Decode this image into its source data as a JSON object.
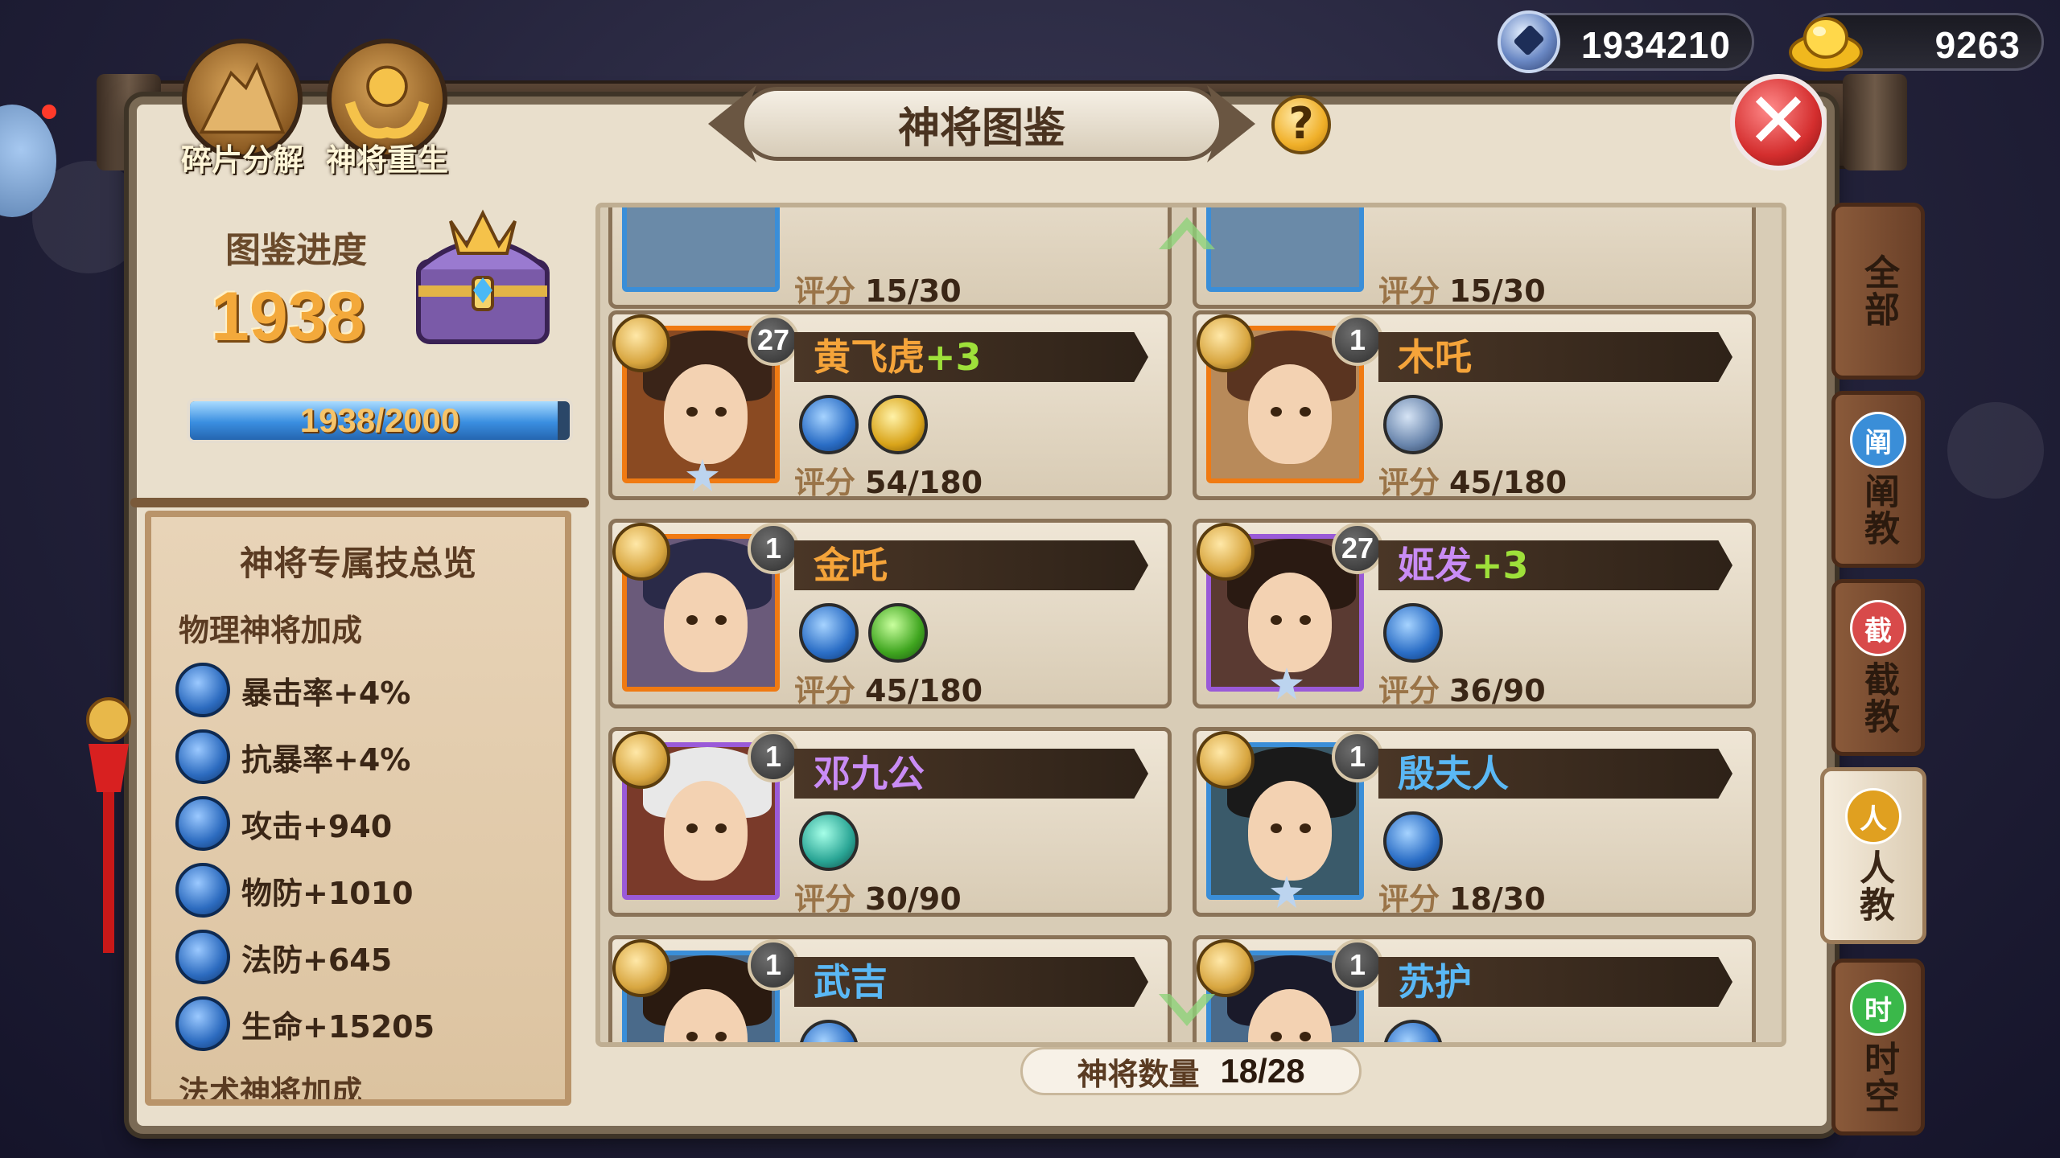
{
  "currency": {
    "diamond": "1934210",
    "gold": "9263"
  },
  "top_buttons": {
    "decompose": "碎片分解",
    "rebirth": "神将重生"
  },
  "title": "神将图鉴",
  "help_symbol": "?",
  "close_symbol": "✕",
  "collection": {
    "label": "图鉴进度",
    "points": "1938",
    "progress_text": "1938/2000",
    "progress_fraction": 0.969
  },
  "bonus_panel": {
    "title": "神将专属技总览",
    "physical_heading": "物理神将加成",
    "items": [
      "暴击率+4%",
      "抗暴率+4%",
      "攻击+940",
      "物防+1010",
      "法防+645",
      "生命+15205"
    ],
    "next_heading": "法术神将加成"
  },
  "score_label": "评分",
  "cards": [
    {
      "name": "",
      "plus": "",
      "level": "",
      "score": "15/30",
      "partial": true
    },
    {
      "name": "",
      "plus": "",
      "level": "",
      "score": "15/30",
      "partial": true
    },
    {
      "name": "黄飞虎",
      "plus": "+3",
      "level": "27",
      "score": "54/180",
      "name_color": "#f5a43a",
      "frame": "#f07a12",
      "hair": "#3a2418",
      "bg": "#8a4a22",
      "role": "shield",
      "skills": [
        "blue",
        "gold"
      ],
      "star": true
    },
    {
      "name": "木吒",
      "plus": "",
      "level": "1",
      "score": "45/180",
      "name_color": "#f5a43a",
      "frame": "#f07a12",
      "hair": "#5a3420",
      "bg": "#b88a5a",
      "role": "sword",
      "skills": [
        "steel"
      ],
      "star": false
    },
    {
      "name": "金吒",
      "plus": "",
      "level": "1",
      "score": "45/180",
      "name_color": "#f5a43a",
      "frame": "#f07a12",
      "hair": "#2a2a48",
      "bg": "#6a5a7a",
      "role": "staff",
      "skills": [
        "blue",
        "green"
      ],
      "star": false
    },
    {
      "name": "姬发",
      "plus": "+3",
      "level": "27",
      "score": "36/90",
      "name_color": "#c98cf5",
      "frame": "#9a5ad8",
      "hair": "#2a1a12",
      "bg": "#5a3a32",
      "role": "shield",
      "skills": [
        "blue"
      ],
      "star": true
    },
    {
      "name": "邓九公",
      "plus": "",
      "level": "1",
      "score": "30/90",
      "name_color": "#c98cf5",
      "frame": "#9a5ad8",
      "hair": "#e8e8e8",
      "bg": "#7a3a2a",
      "role": "sword",
      "skills": [
        "teal"
      ],
      "star": false
    },
    {
      "name": "殷夫人",
      "plus": "",
      "level": "1",
      "score": "18/30",
      "name_color": "#5ab8f5",
      "frame": "#3a8ed8",
      "hair": "#1a1a1a",
      "bg": "#3a5a6a",
      "role": "staff",
      "skills": [
        "blue"
      ],
      "star": true
    },
    {
      "name": "武吉",
      "plus": "",
      "level": "1",
      "score": "",
      "name_color": "#5ab8f5",
      "frame": "#3a8ed8",
      "hair": "#2a1a10",
      "bg": "#4a6a8a",
      "role": "sword",
      "skills": [
        "blue"
      ],
      "star": false
    },
    {
      "name": "苏护",
      "plus": "",
      "level": "1",
      "score": "",
      "name_color": "#5ab8f5",
      "frame": "#3a8ed8",
      "hair": "#1a1a2a",
      "bg": "#4a6a8a",
      "role": "sword",
      "skills": [
        "blue"
      ],
      "star": false
    }
  ],
  "hero_count": {
    "label": "神将数量",
    "value": "18/28"
  },
  "tabs": [
    {
      "label": "全部",
      "icon": "",
      "icon_color": "",
      "active": false
    },
    {
      "label": "阐教",
      "icon": "阐",
      "icon_color": "#3a8ed8",
      "active": false
    },
    {
      "label": "截教",
      "icon": "截",
      "icon_color": "#d84a4a",
      "active": false
    },
    {
      "label": "人教",
      "icon": "人",
      "icon_color": "#e0a020",
      "active": true
    },
    {
      "label": "时空",
      "icon": "时",
      "icon_color": "#3ab84a",
      "active": false
    }
  ]
}
